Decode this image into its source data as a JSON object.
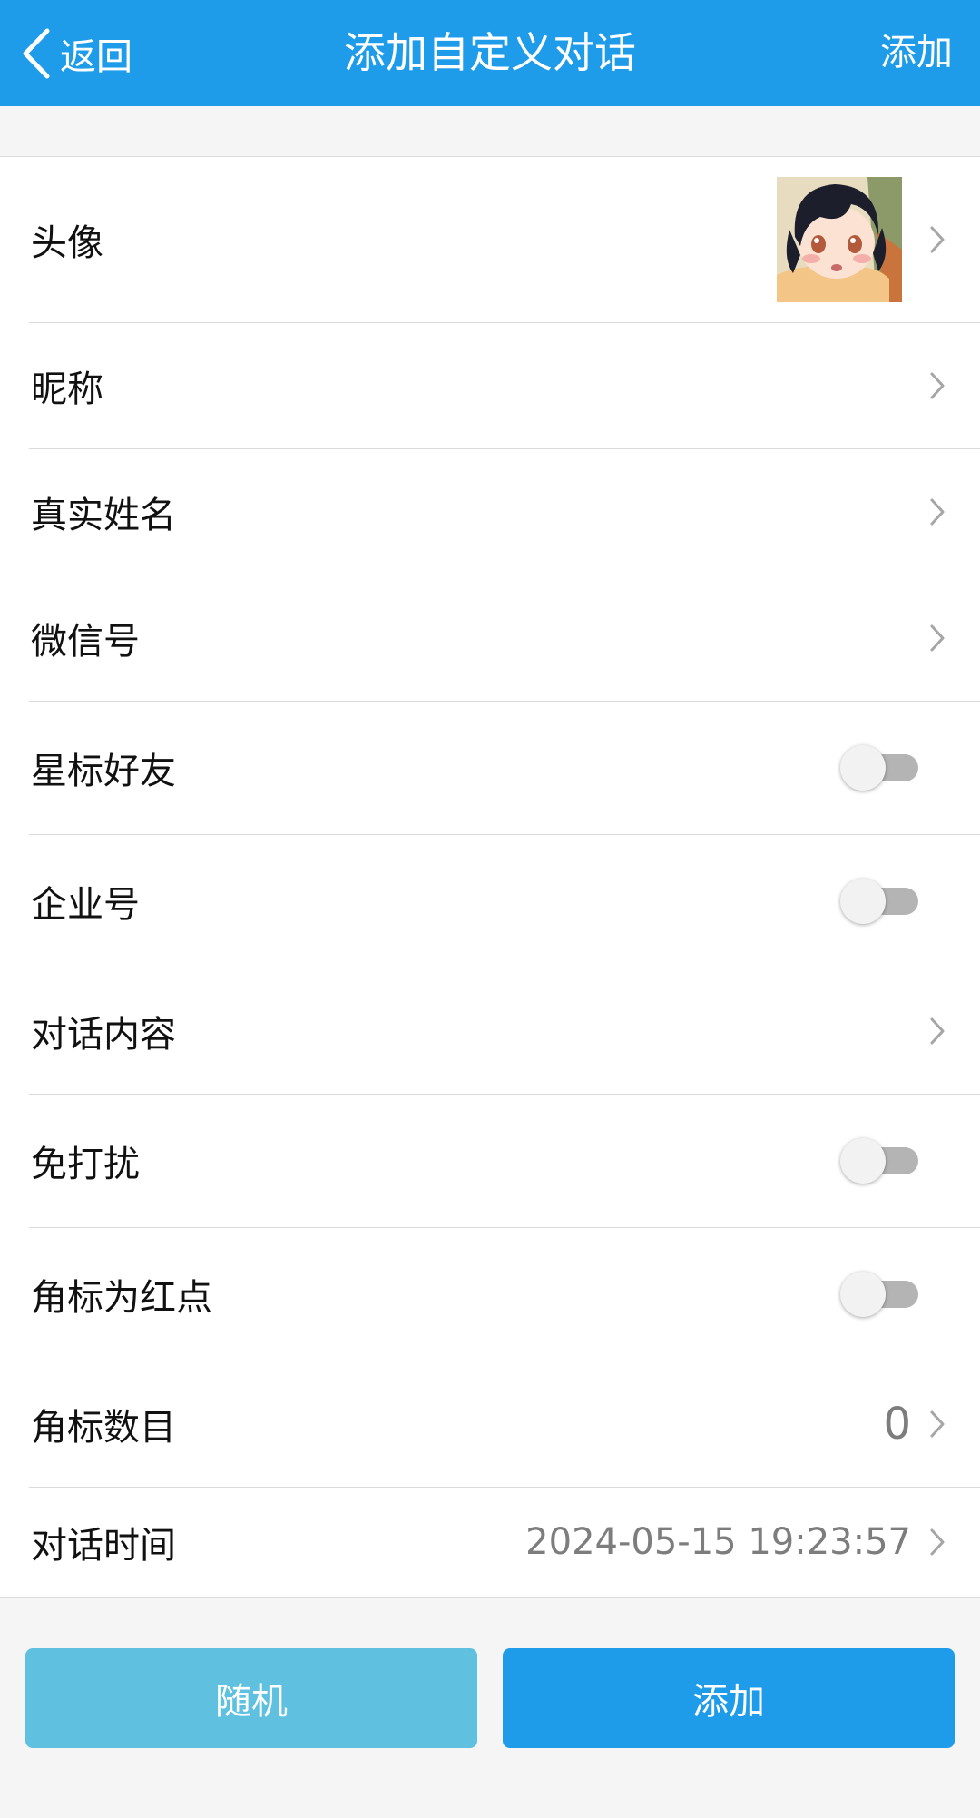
{
  "nav": {
    "back_label": "返回",
    "title": "添加自定义对话",
    "action_label": "添加",
    "color": "#1e9be9"
  },
  "rows": {
    "avatar": {
      "label": "头像"
    },
    "nickname": {
      "label": "昵称"
    },
    "real_name": {
      "label": "真实姓名"
    },
    "wechat_id": {
      "label": "微信号"
    },
    "star_friend": {
      "label": "星标好友",
      "enabled": false
    },
    "enterprise": {
      "label": "企业号",
      "enabled": false
    },
    "dialog_content": {
      "label": "对话内容"
    },
    "do_not_disturb": {
      "label": "免打扰",
      "enabled": false
    },
    "badge_red_dot": {
      "label": "角标为红点",
      "enabled": false
    },
    "badge_count": {
      "label": "角标数目",
      "value": "0"
    },
    "dialog_time": {
      "label": "对话时间",
      "value": "2024-05-15 19:23:57"
    }
  },
  "buttons": {
    "random_label": "随机",
    "add_label": "添加",
    "random_color": "#5fc0e0",
    "add_color": "#1e9be9"
  }
}
